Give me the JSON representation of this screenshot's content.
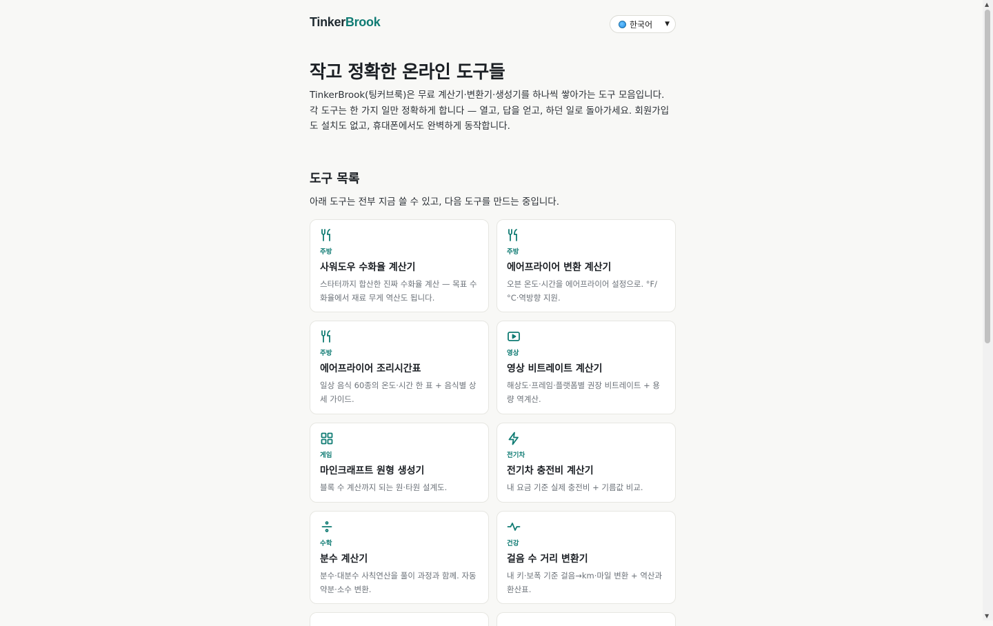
{
  "brand": {
    "part1": "Tinker",
    "part2": "Brook"
  },
  "language": {
    "label": "한국어"
  },
  "hero": {
    "title": "작고 정확한 온라인 도구들",
    "intro": "TinkerBrook(팅커브룩)은 무료 계산기·변환기·생성기를 하나씩 쌓아가는 도구 모음입니다. 각 도구는 한 가지 일만 정확하게 합니다 — 열고, 답을 얻고, 하던 일로 돌아가세요. 회원가입도 설치도 없고, 휴대폰에서도 완벽하게 동작합니다."
  },
  "tools": {
    "heading": "도구 목록",
    "subheading": "아래 도구는 전부 지금 쓸 수 있고, 다음 도구를 만드는 중입니다.",
    "items": [
      {
        "icon": "utensils-icon",
        "category": "주방",
        "title": "사워도우 수화율 계산기",
        "desc": "스타터까지 합산한 진짜 수화율 계산 — 목표 수화율에서 재료 무게 역산도 됩니다."
      },
      {
        "icon": "utensils-icon",
        "category": "주방",
        "title": "에어프라이어 변환 계산기",
        "desc": "오븐 온도·시간을 에어프라이어 설정으로. °F/°C·역방향 지원."
      },
      {
        "icon": "utensils-icon",
        "category": "주방",
        "title": "에어프라이어 조리시간표",
        "desc": "일상 음식 60종의 온도·시간 한 표 + 음식별 상세 가이드."
      },
      {
        "icon": "play-video-icon",
        "category": "영상",
        "title": "영상 비트레이트 계산기",
        "desc": "해상도·프레임·플랫폼별 권장 비트레이트 + 용량 역계산."
      },
      {
        "icon": "grid-blocks-icon",
        "category": "게임",
        "title": "마인크래프트 원형 생성기",
        "desc": "블록 수 계산까지 되는 원·타원 설계도."
      },
      {
        "icon": "lightning-icon",
        "category": "전기차",
        "title": "전기차 충전비 계산기",
        "desc": "내 요금 기준 실제 충전비 + 기름값 비교."
      },
      {
        "icon": "divide-icon",
        "category": "수학",
        "title": "분수 계산기",
        "desc": "분수·대분수 사칙연산을 풀이 과정과 함께. 자동 약분·소수 변환."
      },
      {
        "icon": "pulse-icon",
        "category": "건강",
        "title": "걸음 수 거리 변환기",
        "desc": "내 키·보폭 기준 걸음→km·마일 변환 + 역산과 환산표."
      }
    ]
  }
}
